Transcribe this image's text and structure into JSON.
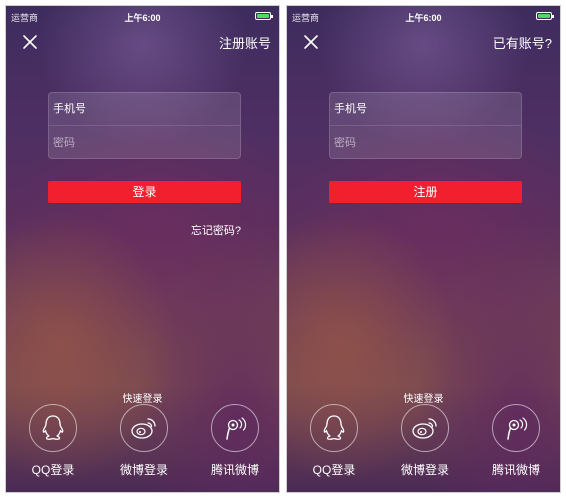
{
  "status_bar": {
    "carrier": "运营商",
    "time": "上午6:00"
  },
  "login_screen": {
    "nav_link": "注册账号",
    "phone_placeholder": "手机号",
    "password_placeholder": "密码",
    "submit_label": "登录",
    "forgot_label": "忘记密码?"
  },
  "register_screen": {
    "nav_link": "已有账号?",
    "phone_placeholder": "手机号",
    "password_placeholder": "密码",
    "submit_label": "注册"
  },
  "quick_login": {
    "title": "快速登录",
    "options": [
      {
        "label": "QQ登录",
        "icon": "qq-icon"
      },
      {
        "label": "微博登录",
        "icon": "weibo-icon"
      },
      {
        "label": "腾讯微博",
        "icon": "tencent-weibo-icon"
      }
    ]
  },
  "colors": {
    "accent_red": "#f2202e",
    "battery_green": "#4cd964"
  },
  "icons": {
    "close": "close-icon",
    "battery": "battery-icon"
  }
}
